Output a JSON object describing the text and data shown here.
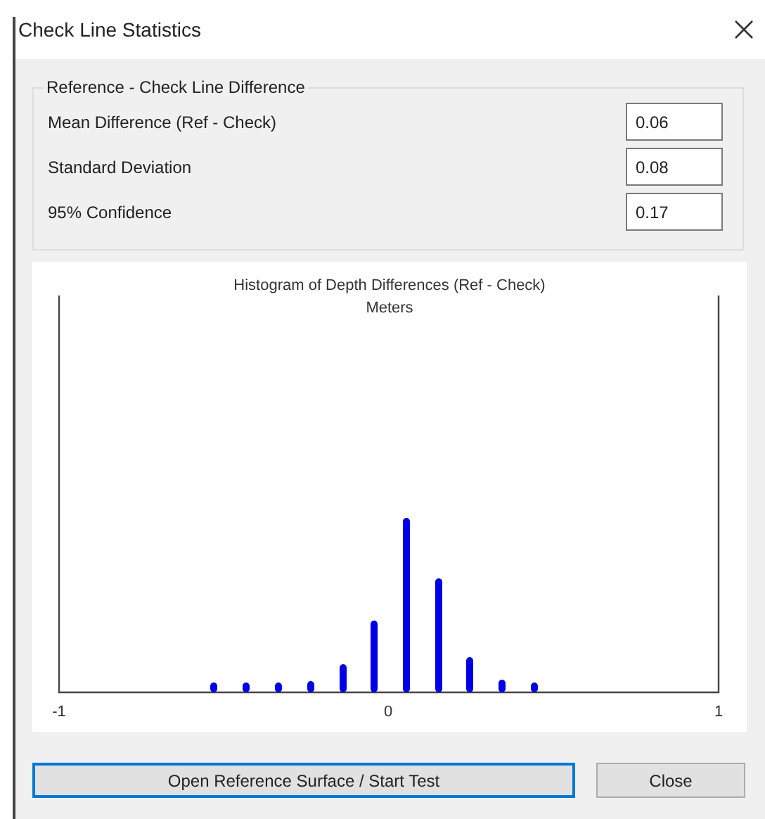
{
  "window": {
    "title": "Check Line Statistics"
  },
  "group": {
    "title": "Reference - Check Line Difference",
    "rows": [
      {
        "label": "Mean Difference (Ref - Check)",
        "value": "0.06"
      },
      {
        "label": "Standard Deviation",
        "value": "0.08"
      },
      {
        "label": "95% Confidence",
        "value": "0.17"
      }
    ]
  },
  "histogram": {
    "title": "Histogram of Depth Differences (Ref - Check)",
    "subtitle": "Meters",
    "tick_labels": [
      "-1",
      "0",
      "1"
    ]
  },
  "buttons": [
    {
      "label": "Open Reference Surface / Start Test",
      "focused": true
    },
    {
      "label": "Close",
      "focused": false
    }
  ]
}
